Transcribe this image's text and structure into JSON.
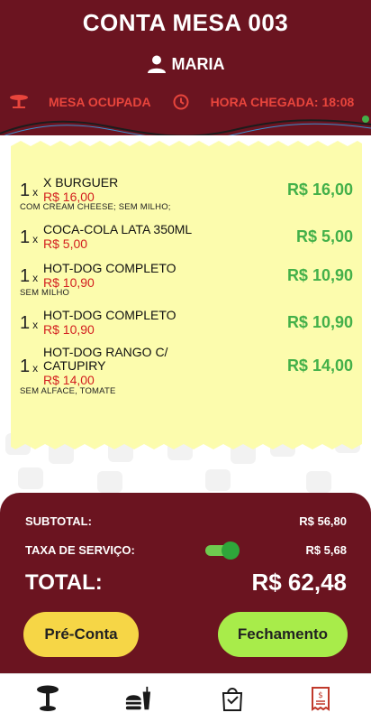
{
  "header": {
    "title": "CONTA MESA 003",
    "user_name": "MARIA",
    "status_label": "MESA OCUPADA",
    "arrival_label": "HORA CHEGADA: 18:08"
  },
  "items": [
    {
      "qty": "1",
      "qty_unit": "x",
      "name": "X BURGUER",
      "unit_price": "R$ 16,00",
      "note": "COM CREAM CHEESE; SEM MILHO;",
      "total": "R$ 16,00"
    },
    {
      "qty": "1",
      "qty_unit": "x",
      "name": "COCA-COLA LATA 350ML",
      "unit_price": "R$ 5,00",
      "note": "",
      "total": "R$ 5,00"
    },
    {
      "qty": "1",
      "qty_unit": "x",
      "name": "HOT-DOG COMPLETO",
      "unit_price": "R$ 10,90",
      "note": "SEM MILHO",
      "total": "R$ 10,90"
    },
    {
      "qty": "1",
      "qty_unit": "x",
      "name": "HOT-DOG COMPLETO",
      "unit_price": "R$ 10,90",
      "note": "",
      "total": "R$ 10,90"
    },
    {
      "qty": "1",
      "qty_unit": "x",
      "name": "HOT-DOG RANGO C/ CATUPIRY",
      "unit_price": "R$ 14,00",
      "note": "SEM ALFACE, TOMATE",
      "total": "R$ 14,00"
    }
  ],
  "summary": {
    "subtotal_label": "SUBTOTAL:",
    "subtotal_value": "R$ 56,80",
    "service_label": "TAXA DE SERVIÇO:",
    "service_value": "R$ 5,68",
    "service_enabled": true,
    "total_label": "TOTAL:",
    "total_value": "R$ 62,48"
  },
  "buttons": {
    "pre_conta": "Pré-Conta",
    "fechamento": "Fechamento"
  },
  "nav": {
    "items": [
      {
        "icon": "table-stool-icon"
      },
      {
        "icon": "fast-food-icon"
      },
      {
        "icon": "shopping-bag-icon"
      },
      {
        "icon": "receipt-dollar-icon"
      }
    ]
  },
  "colors": {
    "primary": "#6b1420",
    "accent_red": "#e8453c",
    "price_green": "#43b049",
    "receipt_yellow": "#fcfcad",
    "button_yellow": "#f6d646",
    "button_green": "#a8ec4a"
  }
}
